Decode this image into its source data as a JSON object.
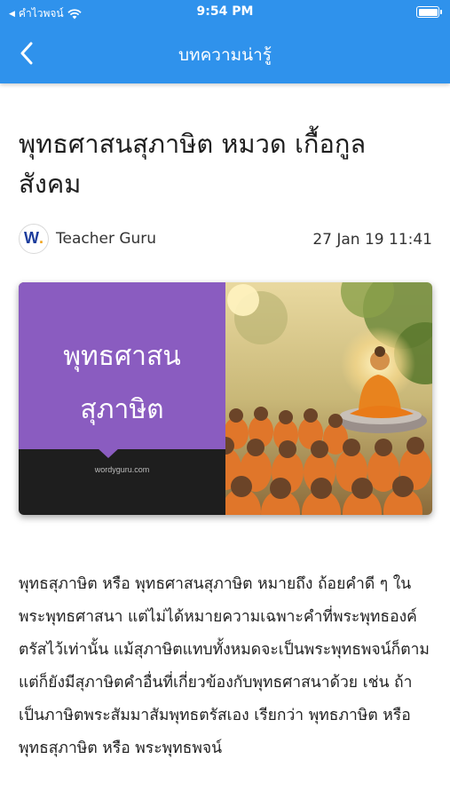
{
  "status_bar": {
    "carrier": "คำไวพจน์",
    "time": "9:54 PM"
  },
  "nav": {
    "title": "บทความน่ารู้",
    "back_icon": "chevron-left-icon"
  },
  "article": {
    "title": "พุทธศาสนสุภาษิต หมวด เกื้อกูล สังคม",
    "author": {
      "avatar_letter": "W",
      "avatar_dot": ".",
      "name": "Teacher Guru"
    },
    "date": "27 Jan 19 11:41",
    "cover": {
      "line1": "พุทธศาสน",
      "line2": "สุภาษิต",
      "site": "wordyguru.com"
    },
    "body": "พุทธสุภาษิต หรือ พุทธศาสนสุภาษิต  หมายถึง ถ้อยคำดี ๆ ในพระพุทธศาสนา  แต่ไม่ได้หมายความเฉพาะคำที่พระพุทธองค์ตรัสไว้เท่านั้น แม้สุภาษิตแทบทั้งหมดจะเป็นพระพุทธพจน์ก็ตาม แต่ก็ยังมีสุภาษิตคำอื่นที่เกี่ยวข้องกับพุทธศาสนาด้วย เช่น ถ้าเป็นภาษิตพระสัมมาสัมพุทธตรัสเอง เรียกว่า พุทธภาษิต หรือ พุทธสุภาษิต หรือ พระพุทธพจน์"
  },
  "colors": {
    "header": "#2f92ec",
    "cover_purple": "#8a5cc0",
    "cover_dark": "#1e1e1e"
  }
}
